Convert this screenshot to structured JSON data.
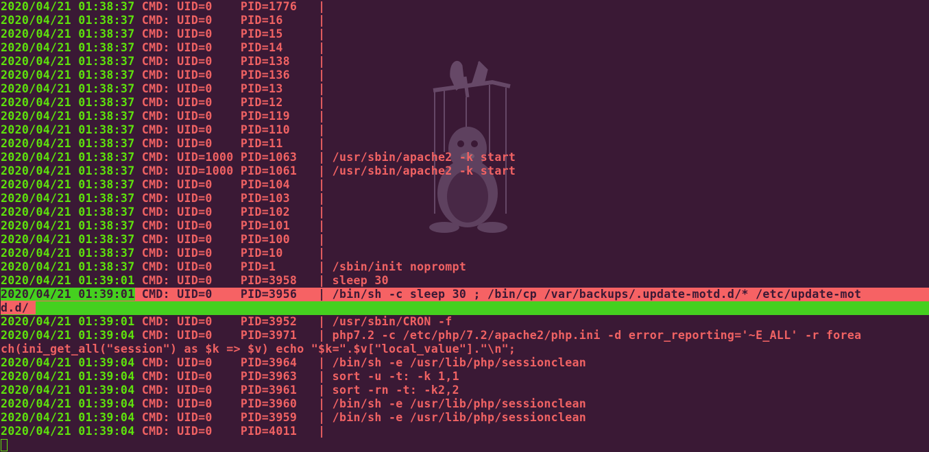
{
  "colors": {
    "background": "#3a1935",
    "timestamp": "#5ee20c",
    "cmd": "#f06263",
    "highlight_red": "#f66264",
    "highlight_green": "#45d01f"
  },
  "logo_icon": "tux-marionette-icon",
  "lines": [
    {
      "ts": "2020/04/21 01:38:37",
      "cmd": "CMD: UID=0    PID=1776   |"
    },
    {
      "ts": "2020/04/21 01:38:37",
      "cmd": "CMD: UID=0    PID=16     |"
    },
    {
      "ts": "2020/04/21 01:38:37",
      "cmd": "CMD: UID=0    PID=15     |"
    },
    {
      "ts": "2020/04/21 01:38:37",
      "cmd": "CMD: UID=0    PID=14     |"
    },
    {
      "ts": "2020/04/21 01:38:37",
      "cmd": "CMD: UID=0    PID=138    |"
    },
    {
      "ts": "2020/04/21 01:38:37",
      "cmd": "CMD: UID=0    PID=136    |"
    },
    {
      "ts": "2020/04/21 01:38:37",
      "cmd": "CMD: UID=0    PID=13     |"
    },
    {
      "ts": "2020/04/21 01:38:37",
      "cmd": "CMD: UID=0    PID=12     |"
    },
    {
      "ts": "2020/04/21 01:38:37",
      "cmd": "CMD: UID=0    PID=119    |"
    },
    {
      "ts": "2020/04/21 01:38:37",
      "cmd": "CMD: UID=0    PID=110    |"
    },
    {
      "ts": "2020/04/21 01:38:37",
      "cmd": "CMD: UID=0    PID=11     |"
    },
    {
      "ts": "2020/04/21 01:38:37",
      "cmd": "CMD: UID=1000 PID=1063   | /usr/sbin/apache2 -k start"
    },
    {
      "ts": "2020/04/21 01:38:37",
      "cmd": "CMD: UID=1000 PID=1061   | /usr/sbin/apache2 -k start"
    },
    {
      "ts": "2020/04/21 01:38:37",
      "cmd": "CMD: UID=0    PID=104    |"
    },
    {
      "ts": "2020/04/21 01:38:37",
      "cmd": "CMD: UID=0    PID=103    |"
    },
    {
      "ts": "2020/04/21 01:38:37",
      "cmd": "CMD: UID=0    PID=102    |"
    },
    {
      "ts": "2020/04/21 01:38:37",
      "cmd": "CMD: UID=0    PID=101    |"
    },
    {
      "ts": "2020/04/21 01:38:37",
      "cmd": "CMD: UID=0    PID=100    |"
    },
    {
      "ts": "2020/04/21 01:38:37",
      "cmd": "CMD: UID=0    PID=10     |"
    },
    {
      "ts": "2020/04/21 01:38:37",
      "cmd": "CMD: UID=0    PID=1      | /sbin/init noprompt"
    },
    {
      "ts": "2020/04/21 01:39:01",
      "cmd": "CMD: UID=0    PID=3958   | sleep 30"
    },
    {
      "ts": "2020/04/21 01:39:01",
      "cmd": "CMD: UID=0    PID=3956   | /bin/sh -c sleep 30 ; /bin/cp /var/backups/.update-motd.d/* /etc/update-mot",
      "highlight": true
    },
    {
      "cont": "d.d/",
      "highlight": true
    },
    {
      "ts": "2020/04/21 01:39:01",
      "cmd": "CMD: UID=0    PID=3952   | /usr/sbin/CRON -f"
    },
    {
      "ts": "2020/04/21 01:39:04",
      "cmd": "CMD: UID=0    PID=3971   | php7.2 -c /etc/php/7.2/apache2/php.ini -d error_reporting='~E_ALL' -r forea"
    },
    {
      "cont": "ch(ini_get_all(\"session\") as $k => $v) echo \"$k=\".$v[\"local_value\"].\"\\n\";"
    },
    {
      "ts": "2020/04/21 01:39:04",
      "cmd": "CMD: UID=0    PID=3964   | /bin/sh -e /usr/lib/php/sessionclean"
    },
    {
      "ts": "2020/04/21 01:39:04",
      "cmd": "CMD: UID=0    PID=3963   | sort -u -t: -k 1,1"
    },
    {
      "ts": "2020/04/21 01:39:04",
      "cmd": "CMD: UID=0    PID=3961   | sort -rn -t: -k2,2"
    },
    {
      "ts": "2020/04/21 01:39:04",
      "cmd": "CMD: UID=0    PID=3960   | /bin/sh -e /usr/lib/php/sessionclean"
    },
    {
      "ts": "2020/04/21 01:39:04",
      "cmd": "CMD: UID=0    PID=3959   | /bin/sh -e /usr/lib/php/sessionclean"
    },
    {
      "ts": "2020/04/21 01:39:04",
      "cmd": "CMD: UID=0    PID=4011   |"
    }
  ]
}
